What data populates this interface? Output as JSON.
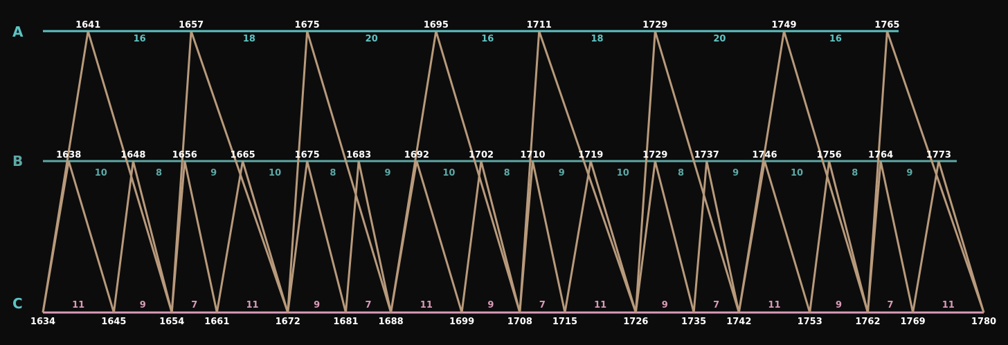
{
  "colors": {
    "background": "#0c0c0c",
    "row_a": "#5cc4c4",
    "row_b": "#5ea9a6",
    "row_c": "#d99bb8",
    "zigzag": "#b89a7c",
    "year_text": "#ffffff"
  },
  "rows": {
    "a": {
      "label": "A",
      "years": [
        1641,
        1657,
        1675,
        1695,
        1711,
        1729,
        1749,
        1765
      ],
      "gaps": [
        "16",
        "18",
        "20",
        "16",
        "18",
        "20",
        "16"
      ]
    },
    "b": {
      "label": "B",
      "years": [
        1638,
        1648,
        1656,
        1665,
        1675,
        1683,
        1692,
        1702,
        1710,
        1719,
        1729,
        1737,
        1746,
        1756,
        1764,
        1773
      ],
      "gaps": [
        "10",
        "8",
        "9",
        "10",
        "8",
        "9",
        "10",
        "8",
        "9",
        "10",
        "8",
        "9",
        "10",
        "8",
        "9"
      ]
    },
    "c": {
      "label": "C",
      "years": [
        1634,
        1645,
        1654,
        1661,
        1672,
        1681,
        1688,
        1699,
        1708,
        1715,
        1726,
        1735,
        1742,
        1753,
        1762,
        1769,
        1780
      ],
      "gaps": [
        "11",
        "9",
        "7",
        "11",
        "9",
        "7",
        "11",
        "9",
        "7",
        "11",
        "9",
        "7",
        "11",
        "9",
        "7",
        "11"
      ]
    }
  },
  "zigzags": [
    {
      "from_row": "a",
      "count": 8
    },
    {
      "from_row": "b",
      "count": 16
    }
  ]
}
